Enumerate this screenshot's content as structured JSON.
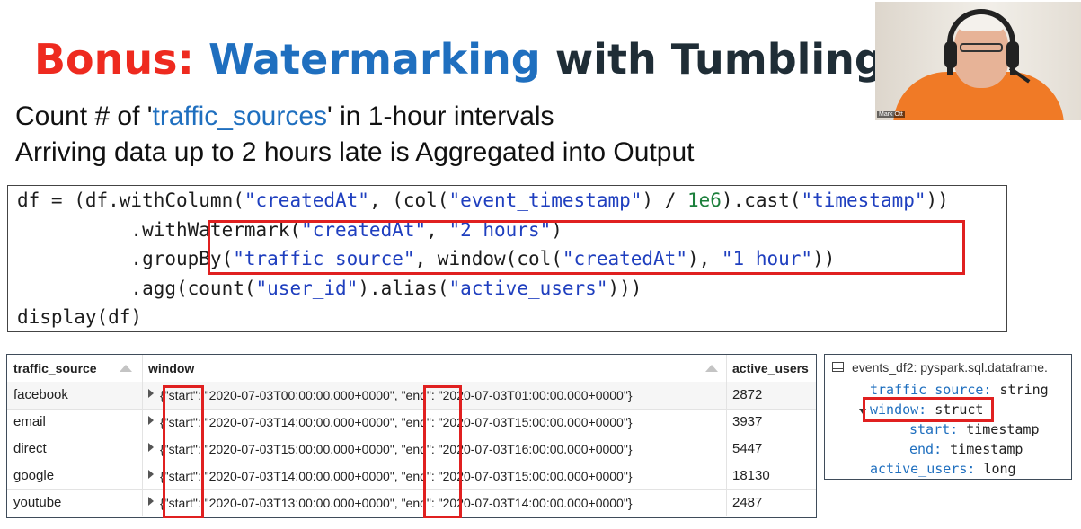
{
  "slide": {
    "title_bonus": "Bonus:",
    "title_watermarking": "Watermarking",
    "title_rest": "with Tumbling W",
    "subtitle1_pre": "Count # of '",
    "subtitle1_key": "traffic_sources",
    "subtitle1_post": "' in 1-hour intervals",
    "subtitle2": "Arriving data up to 2 hours late is Aggregated into Output",
    "colors": {
      "red": "#ee2a1f",
      "blue": "#1f6fbf",
      "dark": "#1f2d36",
      "highlight": "#e02020"
    }
  },
  "webcam": {
    "label": "Mark Ott"
  },
  "code": {
    "line1_a": "df = (df.withColumn(",
    "line1_s1": "\"createdAt\"",
    "line1_b": ", (col(",
    "line1_s2": "\"event_timestamp\"",
    "line1_c": ") / ",
    "line1_n": "1e6",
    "line1_d": ").cast(",
    "line1_s3": "\"timestamp\"",
    "line1_e": "))",
    "line2_a": "          .withWatermark(",
    "line2_s1": "\"createdAt\"",
    "line2_b": ", ",
    "line2_s2": "\"2 hours\"",
    "line2_c": ")",
    "line3_a": "          .groupBy(",
    "line3_s1": "\"traffic_source\"",
    "line3_b": ", window(col(",
    "line3_s2": "\"createdAt\"",
    "line3_c": "), ",
    "line3_s3": "\"1 hour\"",
    "line3_d": "))",
    "line4_a": "          .agg(count(",
    "line4_s1": "\"user_id\"",
    "line4_b": ").alias(",
    "line4_s2": "\"active_users\"",
    "line4_c": ")))",
    "line5": "display(df)"
  },
  "table": {
    "headers": [
      "traffic_source",
      "window",
      "active_users"
    ],
    "rows": [
      {
        "source": "facebook",
        "window": "{\"start\": \"2020-07-03T00:00:00.000+0000\", \"end\": \"2020-07-03T01:00:00.000+0000\"}",
        "active": "2872"
      },
      {
        "source": "email",
        "window": "{\"start\": \"2020-07-03T14:00:00.000+0000\", \"end\": \"2020-07-03T15:00:00.000+0000\"}",
        "active": "3937"
      },
      {
        "source": "direct",
        "window": "{\"start\": \"2020-07-03T15:00:00.000+0000\", \"end\": \"2020-07-03T16:00:00.000+0000\"}",
        "active": "5447"
      },
      {
        "source": "google",
        "window": "{\"start\": \"2020-07-03T14:00:00.000+0000\", \"end\": \"2020-07-03T15:00:00.000+0000\"}",
        "active": "18130"
      },
      {
        "source": "youtube",
        "window": "{\"start\": \"2020-07-03T13:00:00.000+0000\", \"end\": \"2020-07-03T14:00:00.000+0000\"}",
        "active": "2487"
      }
    ]
  },
  "schema": {
    "title": "events_df2:  pyspark.sql.dataframe.",
    "field1_key": "traffic_source:",
    "field1_type": " string",
    "field2_key": "window:",
    "field2_type": " struct",
    "field3_key": "start:",
    "field3_type": " timestamp",
    "field4_key": "end:",
    "field4_type": " timestamp",
    "field5_key": "active_users:",
    "field5_type": " long"
  }
}
